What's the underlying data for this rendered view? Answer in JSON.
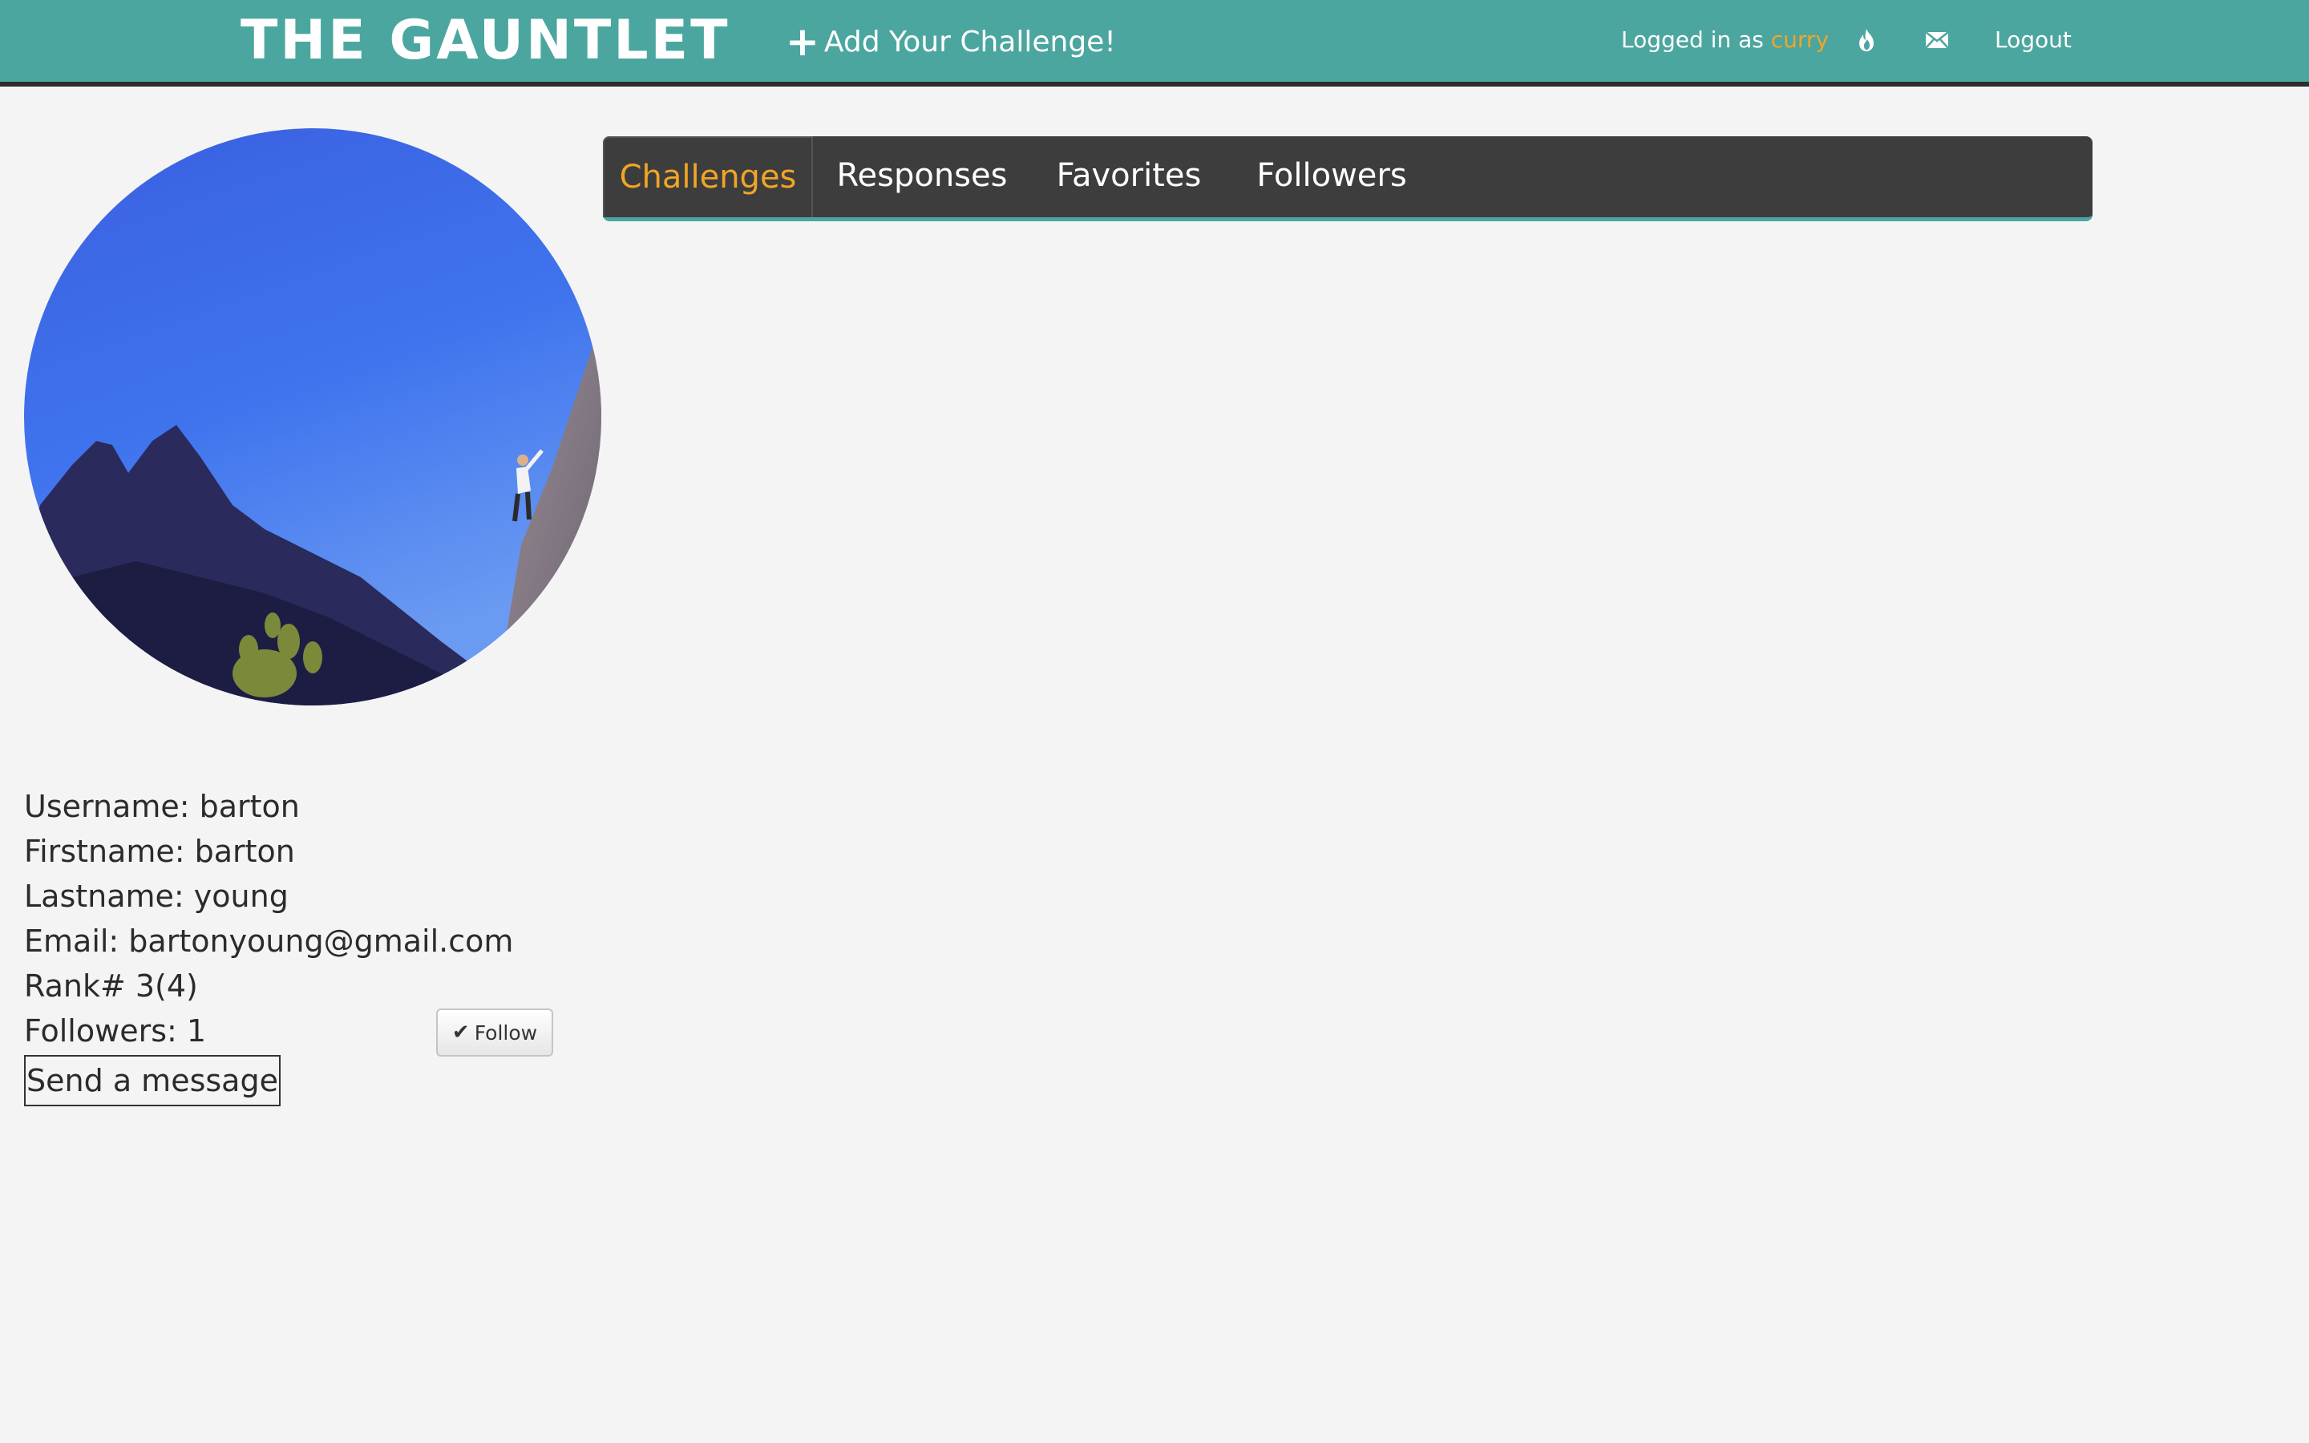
{
  "header": {
    "brand": "THE GAUNTLET",
    "add_challenge_label": "Add Your Challenge!",
    "logged_in_prefix": "Logged in as",
    "logged_in_user": "curry",
    "logout_label": "Logout",
    "icons": [
      "plus-icon",
      "fire-icon",
      "mail-icon"
    ],
    "colors": {
      "header_bg": "#4ba69f",
      "accent": "#f0a526"
    }
  },
  "profile": {
    "avatar_alt": "rock climber on cliff under blue sky",
    "username_label": "Username: barton",
    "firstname_label": "Firstname: barton",
    "lastname_label": "Lastname: young",
    "email_label": "Email: bartonyoung@gmail.com",
    "rank_label": "Rank# 3(4)",
    "followers_label": "Followers: 1",
    "follow_button_label": "Follow",
    "send_message_label": "Send a message"
  },
  "tabs": [
    {
      "label": "Challenges",
      "active": true
    },
    {
      "label": "Responses",
      "active": false
    },
    {
      "label": "Favorites",
      "active": false
    },
    {
      "label": "Followers",
      "active": false
    }
  ]
}
